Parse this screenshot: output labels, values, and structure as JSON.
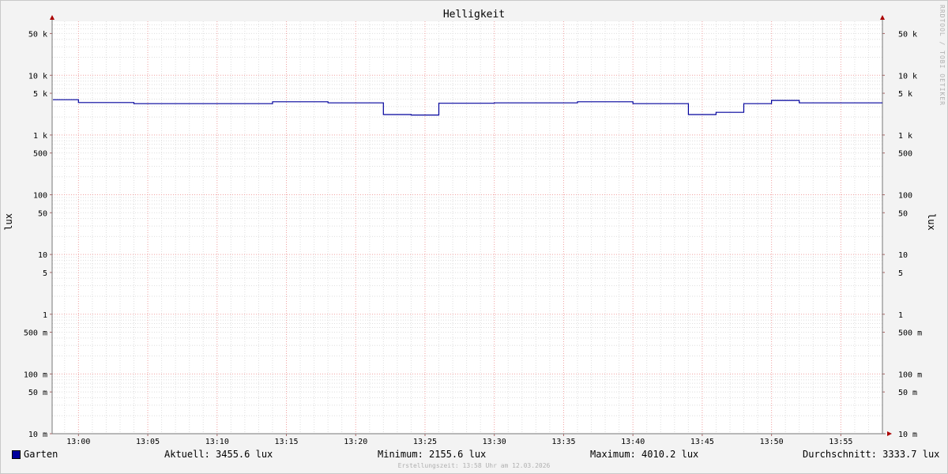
{
  "chart_data": {
    "type": "line",
    "title": "Helligkeit",
    "ylabel": "lux",
    "watermark": "RRDTOOL / TOBI OETIKER",
    "y_scale": "log",
    "ylim": [
      0.01,
      80000
    ],
    "xlim_minutes": [
      12.6,
      58.0
    ],
    "grid": true,
    "x_ticks": [
      {
        "m": 0,
        "label": "13:00"
      },
      {
        "m": 5,
        "label": "13:05"
      },
      {
        "m": 10,
        "label": "13:10"
      },
      {
        "m": 15,
        "label": "13:15"
      },
      {
        "m": 20,
        "label": "13:20"
      },
      {
        "m": 25,
        "label": "13:25"
      },
      {
        "m": 30,
        "label": "13:30"
      },
      {
        "m": 35,
        "label": "13:35"
      },
      {
        "m": 40,
        "label": "13:40"
      },
      {
        "m": 45,
        "label": "13:45"
      },
      {
        "m": 50,
        "label": "13:50"
      },
      {
        "m": 55,
        "label": "13:55"
      }
    ],
    "y_ticks": [
      {
        "v": 0.01,
        "label": "10 m"
      },
      {
        "v": 0.05,
        "label": "50 m"
      },
      {
        "v": 0.1,
        "label": "100 m"
      },
      {
        "v": 0.5,
        "label": "500 m"
      },
      {
        "v": 1,
        "label": "1"
      },
      {
        "v": 5,
        "label": "5"
      },
      {
        "v": 10,
        "label": "10"
      },
      {
        "v": 50,
        "label": "50"
      },
      {
        "v": 100,
        "label": "100"
      },
      {
        "v": 500,
        "label": "500"
      },
      {
        "v": 1000,
        "label": "1 k"
      },
      {
        "v": 5000,
        "label": "5 k"
      },
      {
        "v": 10000,
        "label": "10 k"
      },
      {
        "v": 50000,
        "label": "50 k"
      }
    ],
    "series": [
      {
        "name": "Garten",
        "color": "#00009c",
        "x_minutes": [
          -2,
          0,
          2,
          4,
          6,
          8,
          10,
          12,
          14,
          16,
          18,
          20,
          22,
          24,
          26,
          28,
          30,
          32,
          34,
          36,
          38,
          40,
          42,
          44,
          46,
          48,
          50,
          52,
          54,
          56
        ],
        "values": [
          3900,
          3500,
          3500,
          3350,
          3350,
          3350,
          3350,
          3350,
          3600,
          3600,
          3450,
          3450,
          2200,
          2160,
          3400,
          3400,
          3450,
          3450,
          3450,
          3600,
          3600,
          3350,
          3350,
          2200,
          2400,
          3350,
          3800,
          3450,
          3450,
          3450
        ]
      }
    ]
  },
  "legend": {
    "series_name": "Garten",
    "aktuell": "Aktuell: 3455.6 lux",
    "minimum": "Minimum: 2155.6 lux",
    "maximum": "Maximum: 4010.2 lux",
    "durchschnitt": "Durchschnitt: 3333.7 lux"
  },
  "footer": "Erstellungszeit: 13:58 Uhr am 12.03.2026"
}
